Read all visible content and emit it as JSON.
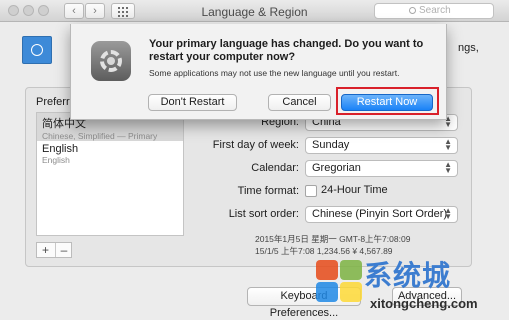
{
  "window": {
    "title": "Language & Region",
    "search_placeholder": "Search",
    "nav_back": "‹",
    "nav_forward": "›"
  },
  "header": {
    "description_tail": "ngs,"
  },
  "preferred": {
    "label": "Preferre",
    "languages": [
      {
        "name": "简体中文",
        "subtitle": "Chinese, Simplified — Primary"
      },
      {
        "name": "English",
        "subtitle": "English"
      }
    ],
    "add_label": "+",
    "remove_label": "–"
  },
  "settings": {
    "region": {
      "label": "Region:",
      "value": "China"
    },
    "first_day": {
      "label": "First day of week:",
      "value": "Sunday"
    },
    "calendar": {
      "label": "Calendar:",
      "value": "Gregorian"
    },
    "time_format": {
      "label": "Time format:",
      "checkbox_label": "24-Hour Time",
      "checked": false
    },
    "sort_order": {
      "label": "List sort order:",
      "value": "Chinese (Pinyin Sort Order)"
    }
  },
  "sample": {
    "line1": "2015年1月5日 星期一 GMT-8上午7:08:09",
    "line2": "15/1/5 上午7:08    1,234.56    ¥ 4,567.89"
  },
  "footer": {
    "keyboard_button": "Keyboard Preferences...",
    "advanced_button": "Advanced..."
  },
  "sheet": {
    "message": "Your primary language has changed. Do you want to restart your computer now?",
    "informative": "Some applications may not use the new language until you restart.",
    "dont_restart": "Don't Restart",
    "cancel": "Cancel",
    "restart_now": "Restart Now"
  },
  "watermark": {
    "text": "系统城",
    "url": "xitongcheng.com"
  },
  "colors": {
    "accent": "#1a82f7",
    "highlight_box": "#d9202a"
  }
}
